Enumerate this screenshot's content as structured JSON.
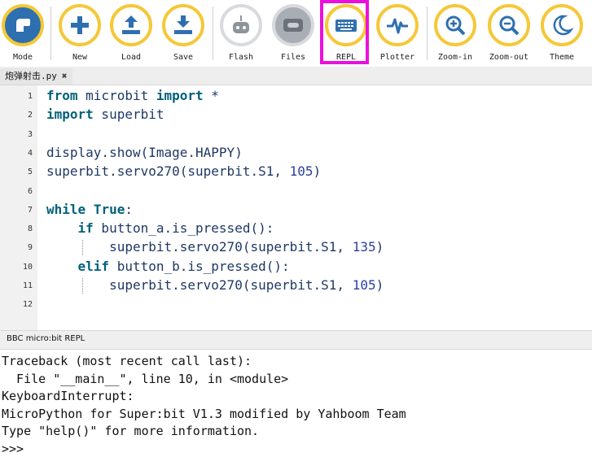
{
  "toolbar": {
    "buttons": [
      {
        "label": "Mode",
        "icon": "mode-icon"
      },
      {
        "label": "New",
        "icon": "plus-icon"
      },
      {
        "label": "Load",
        "icon": "upload-icon"
      },
      {
        "label": "Save",
        "icon": "download-icon"
      },
      {
        "label": "Flash",
        "icon": "flash-icon"
      },
      {
        "label": "Files",
        "icon": "files-icon"
      },
      {
        "label": "REPL",
        "icon": "keyboard-icon"
      },
      {
        "label": "Plotter",
        "icon": "pulse-icon"
      },
      {
        "label": "Zoom-in",
        "icon": "zoom-in-icon"
      },
      {
        "label": "Zoom-out",
        "icon": "zoom-out-icon"
      },
      {
        "label": "Theme",
        "icon": "moon-icon"
      }
    ],
    "highlighted": "REPL",
    "highlight_color": "#ea10dc",
    "accent_color": "#f5c838",
    "icon_color": "#2e6fb0"
  },
  "tab": {
    "filename": "炮弹射击.py",
    "close_glyph": "✖"
  },
  "editor": {
    "line_numbers": [
      "1",
      "2",
      "3",
      "4",
      "5",
      "6",
      "7",
      "8",
      "9",
      "10",
      "11",
      "12"
    ],
    "lines": [
      [
        {
          "t": "from",
          "k": "kw"
        },
        {
          "t": " microbit ",
          "k": ""
        },
        {
          "t": "import",
          "k": "kw"
        },
        {
          "t": " *",
          "k": ""
        }
      ],
      [
        {
          "t": "import",
          "k": "kw"
        },
        {
          "t": " superbit",
          "k": ""
        }
      ],
      [],
      [
        {
          "t": "display.show(Image.HAPPY)",
          "k": ""
        }
      ],
      [
        {
          "t": "superbit.servo270(superbit.S1, ",
          "k": ""
        },
        {
          "t": "105",
          "k": "num-lit"
        },
        {
          "t": ")",
          "k": ""
        }
      ],
      [],
      [
        {
          "t": "while",
          "k": "kw"
        },
        {
          "t": " ",
          "k": ""
        },
        {
          "t": "True",
          "k": "kw"
        },
        {
          "t": ":",
          "k": ""
        }
      ],
      [
        {
          "t": "    ",
          "k": ""
        },
        {
          "t": "if",
          "k": "kw"
        },
        {
          "t": " button_a.is_pressed():",
          "k": ""
        }
      ],
      [
        {
          "t": "        superbit.servo270(superbit.S1, ",
          "k": ""
        },
        {
          "t": "135",
          "k": "num-lit"
        },
        {
          "t": ")",
          "k": ""
        }
      ],
      [
        {
          "t": "    ",
          "k": ""
        },
        {
          "t": "elif",
          "k": "kw"
        },
        {
          "t": " button_b.is_pressed():",
          "k": ""
        }
      ],
      [
        {
          "t": "        superbit.servo270(superbit.S1, ",
          "k": ""
        },
        {
          "t": "105",
          "k": "num-lit"
        },
        {
          "t": ")",
          "k": ""
        }
      ],
      []
    ]
  },
  "repl": {
    "title": "BBC micro:bit REPL",
    "lines": [
      "Traceback (most recent call last):",
      "  File \"__main__\", line 10, in <module>",
      "KeyboardInterrupt:",
      "MicroPython for Super:bit V1.3 modified by Yahboom Team",
      "Type \"help()\" for more information.",
      ">>>"
    ]
  }
}
